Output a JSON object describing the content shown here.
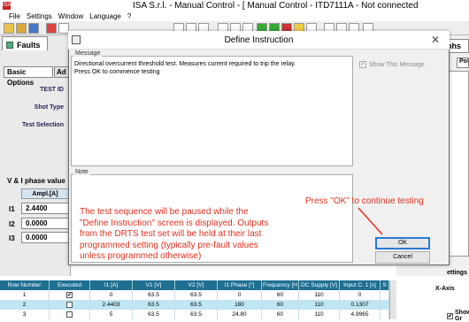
{
  "app": {
    "title": "ISA S.r.l. - Manual Control - [ Manual Control - ITD7111A - Not connected",
    "icon_label": "ISA"
  },
  "menu": [
    "File",
    "Settings",
    "Window",
    "Language",
    "?"
  ],
  "left_panel": {
    "faults_tab": "Faults",
    "tabs": [
      "Basic Options",
      "Ad"
    ],
    "fields": [
      "TEST ID",
      "Shot Type",
      "Test Selection"
    ],
    "vi_label": "V & I phase value",
    "ampl_header": "Ampl.[A]",
    "currents": [
      {
        "label": "I1",
        "value": "2.4400"
      },
      {
        "label": "I2",
        "value": "0.0000"
      },
      {
        "label": "I3",
        "value": "0.0000"
      }
    ]
  },
  "right_panel": {
    "graphs_tab": "aphs",
    "pol_tab": "Pol",
    "settings_label": "ettings",
    "xaxis_label": "X-Axis",
    "show_label": "Show Gr"
  },
  "dialog": {
    "title": "Define Instruction",
    "close_glyph": "✕",
    "message_label": "Message",
    "message_text": "Directional overcurrent threshold test.  Measures current required to trip the relay.\nPress OK to commence testing",
    "show_message_label": "Show This Message",
    "note_label": "Note",
    "ok_label": "OK",
    "cancel_label": "Cancel"
  },
  "annotations": {
    "note_text": "The test sequence will be paused while the \"Define Instruction\" screen is displayed. Outputs from the DRTS test set will be held at their last programmed setting (typically pre-fault values unless programmed otherwise)",
    "ok_hint": "Press \"OK\" to continue testing",
    "color": "#e0301e"
  },
  "table": {
    "headers": [
      "Row Number",
      "Executed",
      "I1 [A]",
      "V1 [V]",
      "V2 [V]",
      "I1 Phase [°]",
      "Frequency [H",
      "DC Supply [V]",
      "Input C. 1 [s]",
      "S"
    ],
    "rows": [
      [
        "1",
        "✔",
        "0",
        "63.5",
        "63.5",
        "0",
        "60",
        "110",
        "0",
        ""
      ],
      [
        "2",
        "",
        "2.4403",
        "63.5",
        "63.5",
        "180",
        "60",
        "110",
        "0.1307",
        ""
      ],
      [
        "3",
        "",
        "5",
        "63.5",
        "63.5",
        "24.80",
        "60",
        "110",
        "4.9965",
        ""
      ]
    ]
  }
}
